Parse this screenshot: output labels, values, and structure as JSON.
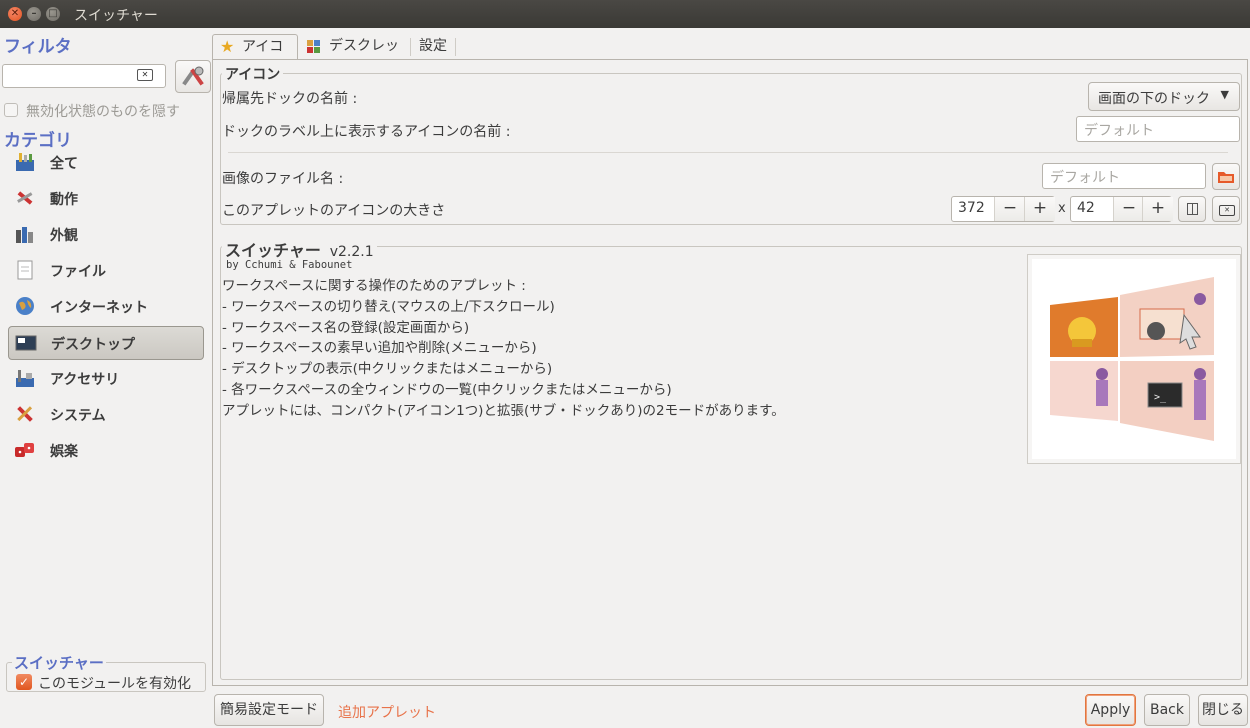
{
  "window": {
    "title": "スイッチャー"
  },
  "filter": {
    "title": "フィルタ",
    "search_value": "",
    "hide_disabled_label": "無効化状態のものを隠す"
  },
  "categories": {
    "title": "カテゴリ",
    "items": [
      {
        "label": "全て",
        "icon": "all-icon"
      },
      {
        "label": "動作",
        "icon": "behavior-icon"
      },
      {
        "label": "外観",
        "icon": "appearance-icon"
      },
      {
        "label": "ファイル",
        "icon": "files-icon"
      },
      {
        "label": "インターネット",
        "icon": "internet-icon"
      },
      {
        "label": "デスクトップ",
        "icon": "desktop-icon",
        "selected": true
      },
      {
        "label": "アクセサリ",
        "icon": "accessories-icon"
      },
      {
        "label": "システム",
        "icon": "system-icon"
      },
      {
        "label": "娯楽",
        "icon": "fun-icon"
      }
    ]
  },
  "module": {
    "title": "スイッチャー",
    "enable_label": "このモジュールを有効化",
    "enabled": true
  },
  "tabs": [
    {
      "label": "アイコン",
      "icon": "star-icon",
      "active": true
    },
    {
      "label": "デスクレット",
      "icon": "desklet-icon"
    },
    {
      "label": "設定"
    }
  ],
  "icon_group": {
    "title": "アイコン",
    "dock_label": "帰属先ドックの名前 :",
    "dock_value": "画面の下のドック",
    "dock_icon_label": "ドックのラベル上に表示するアイコンの名前 :",
    "dock_icon_placeholder": "デフォルト",
    "image_label": "画像のファイル名 :",
    "image_placeholder": "デフォルト",
    "size_label": "このアプレットのアイコンの大きさ",
    "size_width": "372",
    "size_height": "42",
    "size_x": "x"
  },
  "applet": {
    "name": "スイッチャー",
    "version": "v2.2.1",
    "authors": "by Cchumi & Fabounet",
    "description": [
      "ワークスペースに関する操作のためのアプレット :",
      " - ワークスペースの切り替え(マウスの上/下スクロール)",
      " - ワークスペース名の登録(設定画面から)",
      " - ワークスペースの素早い追加や削除(メニューから)",
      " - デスクトップの表示(中クリックまたはメニューから)",
      " - 各ワークスペースの全ウィンドウの一覧(中クリックまたはメニューから)",
      "アプレットには、コンパクト(アイコン1つ)と拡張(サブ・ドックあり)の2モードがあります。"
    ]
  },
  "footer": {
    "simple_mode": "簡易設定モード",
    "add_applets": "追加アプレット",
    "apply": "Apply",
    "back": "Back",
    "close": "閉じる"
  },
  "colors": {
    "accent_blue": "#5b6fc4",
    "accent_orange": "#e1561f"
  }
}
